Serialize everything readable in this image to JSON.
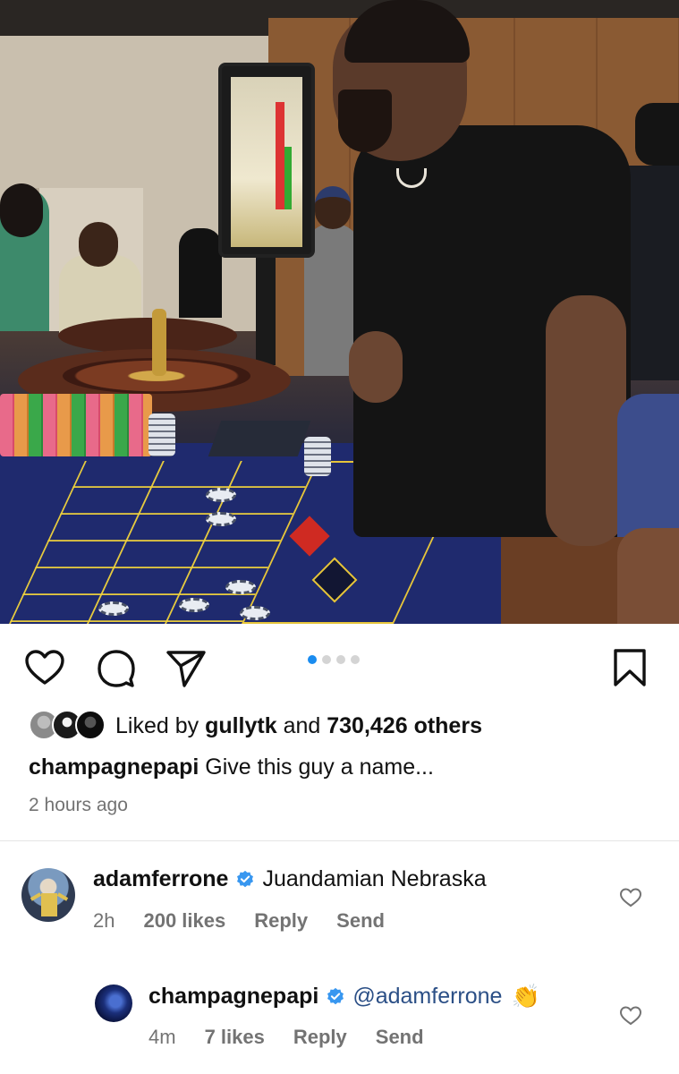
{
  "post": {
    "image_alt": "Casino roulette table photo",
    "carousel": {
      "count": 4,
      "active_index": 0
    },
    "actions": {
      "like_icon": "heart-outline-icon",
      "comment_icon": "comment-bubble-icon",
      "share_icon": "paper-plane-icon",
      "save_icon": "bookmark-icon"
    },
    "likes": {
      "prefix": "Liked by ",
      "user": "gullytk",
      "connector": " and ",
      "others": "730,426 others"
    },
    "caption": {
      "username": "champagnepapi",
      "text": " Give this guy a name..."
    },
    "time_ago": "2 hours ago"
  },
  "comments": [
    {
      "username": "adamferrone",
      "verified": true,
      "text": "Juandamian Nebraska",
      "age": "2h",
      "likes": "200 likes",
      "reply_label": "Reply",
      "send_label": "Send"
    },
    {
      "username": "champagnepapi",
      "verified": true,
      "mention": "@adamferrone",
      "emoji": "👏",
      "age": "4m",
      "likes": "7 likes",
      "reply_label": "Reply",
      "send_label": "Send"
    }
  ],
  "colors": {
    "accent_blue": "#1a8cf0",
    "verified_blue": "#3897f0",
    "mention": "#2b4f86",
    "muted_text": "#737373"
  }
}
